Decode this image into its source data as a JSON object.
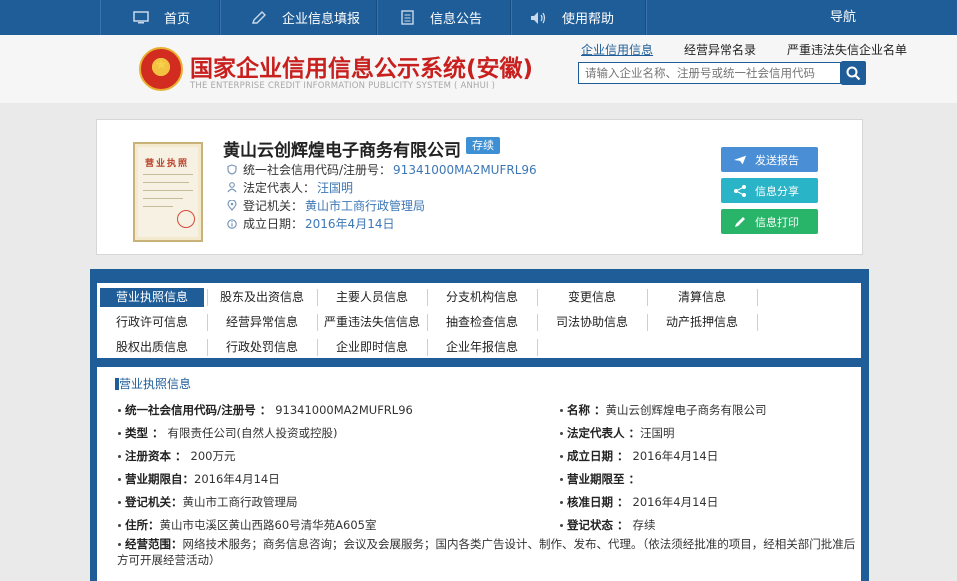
{
  "nav": {
    "items": [
      {
        "label": "首页",
        "icon": "monitor-icon"
      },
      {
        "label": "企业信息填报",
        "icon": "edit-icon"
      },
      {
        "label": "信息公告",
        "icon": "document-icon"
      },
      {
        "label": "使用帮助",
        "icon": "speaker-icon"
      }
    ],
    "guide": "导航"
  },
  "header": {
    "title": "国家企业信用信息公示系统(安徽)",
    "subtitle": "THE ENTERPRISE CREDIT INFORMATION PUBLICITY SYSTEM ( ANHUI )",
    "links": [
      "企业信用信息",
      "经营异常名录",
      "严重违法失信企业名单"
    ],
    "search_placeholder": "请输入企业名称、注册号或统一社会信用代码",
    "brand_color": "#1f5d99"
  },
  "company": {
    "name": "黄山云创辉煌电子商务有限公司",
    "status": "存续",
    "license_text": "营业执照",
    "credit_code_label": "统一社会信用代码/注册号：",
    "credit_code": "91341000MA2MUFRL96",
    "rep_label": "法定代表人：",
    "rep": "汪国明",
    "authority_label": "登记机关：",
    "authority": "黄山市工商行政管理局",
    "established_label": "成立日期：",
    "established": "2016年4月14日",
    "actions": [
      {
        "label": "发送报告",
        "color": "#4a8fd6"
      },
      {
        "label": "信息分享",
        "color": "#2ab4c7"
      },
      {
        "label": "信息打印",
        "color": "#28b56a"
      }
    ]
  },
  "tabs": [
    [
      "营业执照信息",
      "股东及出资信息",
      "主要人员信息",
      "分支机构信息",
      "变更信息",
      "清算信息"
    ],
    [
      "行政许可信息",
      "经营异常信息",
      "严重违法失信信息",
      "抽查检查信息",
      "司法协助信息",
      "动产抵押信息"
    ],
    [
      "股权出质信息",
      "行政处罚信息",
      "企业即时信息",
      "企业年报信息"
    ]
  ],
  "info": {
    "section_title": "营业执照信息",
    "left": [
      {
        "label": "统一社会信用代码/注册号",
        "value": "91341000MA2MUFRL96"
      },
      {
        "label": "类型",
        "value": "有限责任公司(自然人投资或控股)"
      },
      {
        "label": "注册资本",
        "value": "200万元"
      },
      {
        "label": "营业期限自",
        "value": "2016年4月14日"
      },
      {
        "label": "登记机关",
        "value": "黄山市工商行政管理局"
      },
      {
        "label": "住所",
        "value": "黄山市屯溪区黄山西路60号清华苑A605室"
      }
    ],
    "right": [
      {
        "label": "名称",
        "value": "黄山云创辉煌电子商务有限公司"
      },
      {
        "label": "法定代表人",
        "value": "汪国明"
      },
      {
        "label": "成立日期",
        "value": "2016年4月14日"
      },
      {
        "label": "营业期限至",
        "value": ""
      },
      {
        "label": "核准日期",
        "value": "2016年4月14日"
      },
      {
        "label": "登记状态",
        "value": "存续"
      }
    ],
    "scope_label": "经营范围",
    "scope": "网络技术服务；商务信息咨询；会议及会展服务；国内各类广告设计、制作、发布、代理。（依法须经批准的项目，经相关部门批准后方可开展经营活动）"
  }
}
